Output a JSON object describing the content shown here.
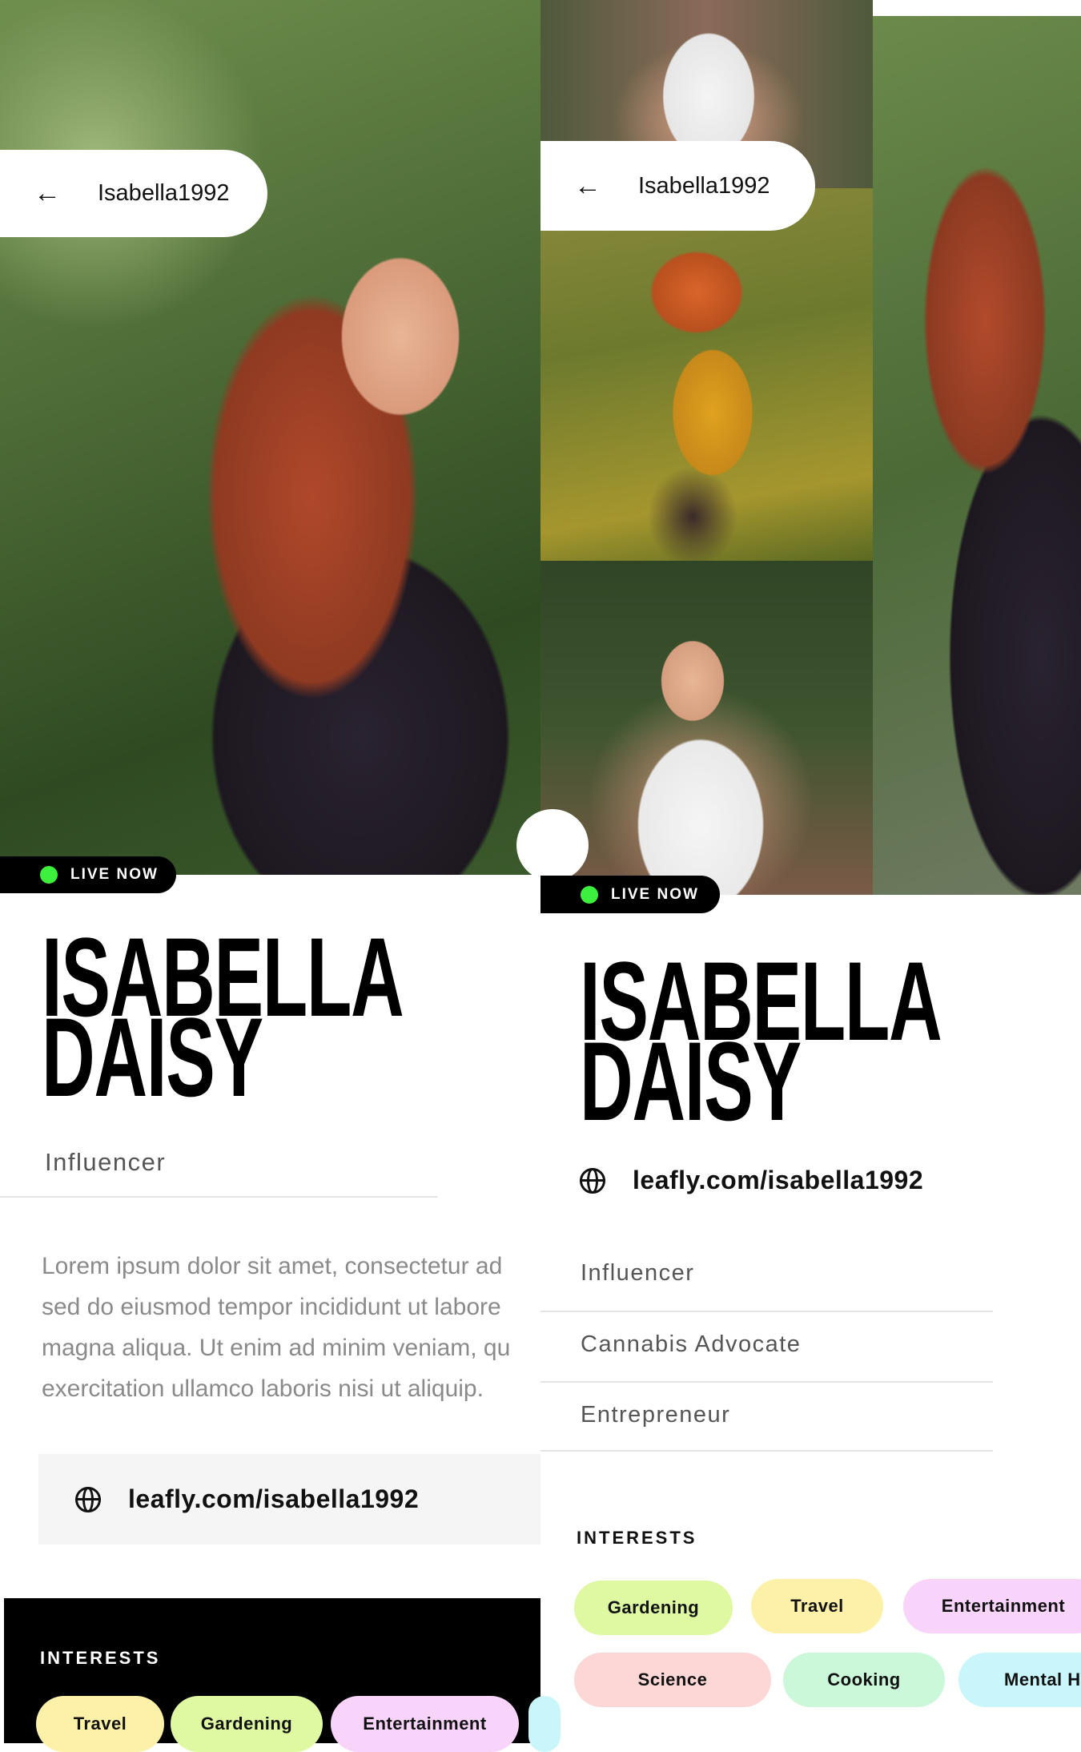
{
  "header": {
    "back_icon": "arrow-left-icon",
    "username": "Isabella1992"
  },
  "live_badge": {
    "label": "LIVE NOW",
    "dot_color": "#3ef03e"
  },
  "profile": {
    "first_name": "ISABELLA",
    "last_name": "DAISY",
    "website": "leafly.com/isabella1992",
    "bio_lines": [
      "Lorem ipsum dolor sit amet, consectetur ad",
      "sed do eiusmod tempor incididunt ut labore",
      "magna aliqua. Ut enim ad minim veniam, qu",
      "exercitation ullamco laboris nisi ut aliquip."
    ],
    "roles": [
      "Influencer",
      "Cannabis Advocate",
      "Entrepreneur"
    ]
  },
  "interests_label": "INTERESTS",
  "left_interests": [
    {
      "label": "Travel",
      "color": "#fdf0a8"
    },
    {
      "label": "Gardening",
      "color": "#def9a2"
    },
    {
      "label": "Entertainment",
      "color": "#f8d4fb"
    }
  ],
  "mid_interests": [
    {
      "label": "Gardening",
      "color": "#def9a2"
    },
    {
      "label": "Travel",
      "color": "#fdf0a8"
    },
    {
      "label": "Entertainment",
      "color": "#f8d4fb"
    },
    {
      "label": "Science",
      "color": "#fdd6d6"
    },
    {
      "label": "Cooking",
      "color": "#ccf8da"
    },
    {
      "label": "Mental He",
      "color": "#c9f6fb"
    }
  ]
}
